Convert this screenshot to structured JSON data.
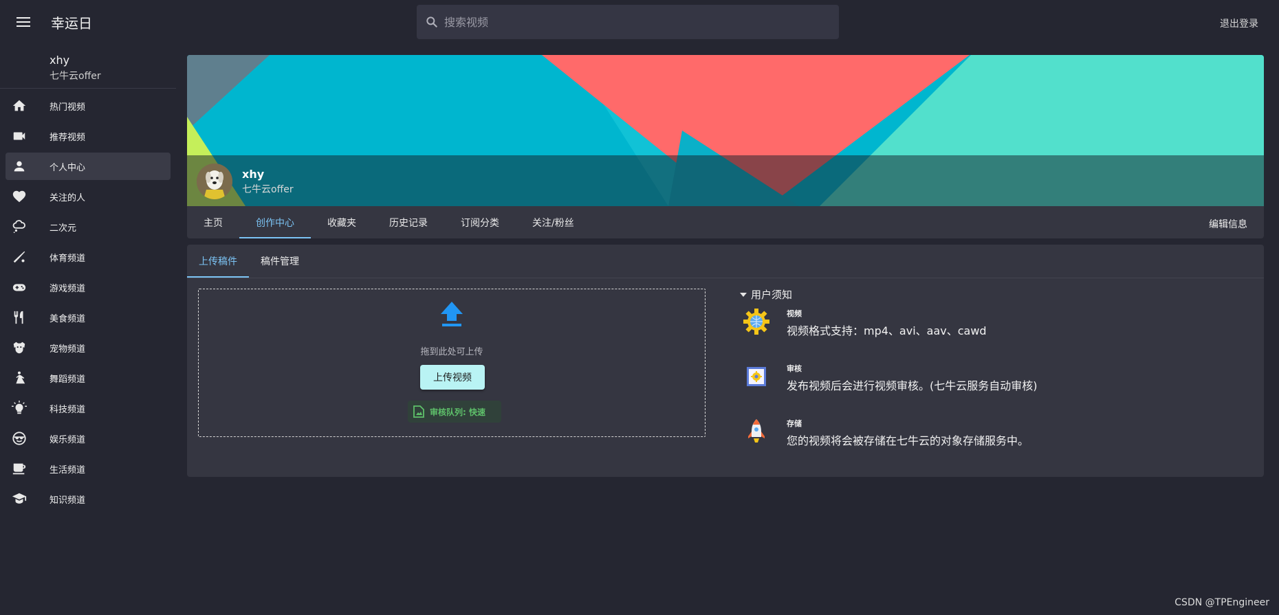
{
  "header": {
    "app_title": "幸运日",
    "search_placeholder": "搜索视频",
    "logout_label": "退出登录"
  },
  "sidebar": {
    "user": {
      "name": "xhy",
      "subtitle": "七牛云offer"
    },
    "items": [
      {
        "label": "热门视频",
        "icon": "home-icon"
      },
      {
        "label": "推荐视频",
        "icon": "video-camera-icon"
      },
      {
        "label": "个人中心",
        "icon": "person-icon",
        "active": true
      },
      {
        "label": "关注的人",
        "icon": "heart-icon"
      },
      {
        "label": "二次元",
        "icon": "cloud-thought-icon"
      },
      {
        "label": "体育频道",
        "icon": "baseball-bat-icon"
      },
      {
        "label": "游戏频道",
        "icon": "gamepad-icon"
      },
      {
        "label": "美食频道",
        "icon": "fork-knife-icon"
      },
      {
        "label": "宠物频道",
        "icon": "pet-icon"
      },
      {
        "label": "舞蹈频道",
        "icon": "dance-icon"
      },
      {
        "label": "科技频道",
        "icon": "lightbulb-icon"
      },
      {
        "label": "娱乐频道",
        "icon": "sunglasses-face-icon"
      },
      {
        "label": "生活频道",
        "icon": "coffee-cup-icon"
      },
      {
        "label": "知识频道",
        "icon": "graduation-icon"
      }
    ]
  },
  "profile_banner": {
    "name": "xhy",
    "subtitle": "七牛云offer",
    "colors": {
      "teal": "#00b6cf",
      "coral": "#ff6a6a",
      "mint": "#52e0cc",
      "lime": "#c5ef5a"
    }
  },
  "profile_tabs": {
    "items": [
      {
        "label": "主页"
      },
      {
        "label": "创作中心",
        "active": true
      },
      {
        "label": "收藏夹"
      },
      {
        "label": "历史记录"
      },
      {
        "label": "订阅分类"
      },
      {
        "label": "关注/粉丝"
      }
    ],
    "edit_label": "编辑信息"
  },
  "creation": {
    "tabs": [
      {
        "label": "上传稿件",
        "active": true
      },
      {
        "label": "稿件管理"
      }
    ],
    "dropzone": {
      "hint": "拖到此处可上传",
      "upload_button": "上传视频",
      "queue_label": "审核队列: 快速"
    },
    "notice": {
      "title": "用户须知",
      "items": [
        {
          "title": "视频",
          "desc": "视频格式支持：mp4、avi、aav、cawd",
          "icon": "gear-globe-icon"
        },
        {
          "title": "审核",
          "desc": "发布视频后会进行视频审核。(七牛云服务自动审核)",
          "icon": "chip-gear-icon"
        },
        {
          "title": "存储",
          "desc": "您的视频将会被存储在七牛云的对象存储服务中。",
          "icon": "rocket-icon"
        }
      ]
    }
  },
  "watermark": "CSDN @TPEngineer"
}
